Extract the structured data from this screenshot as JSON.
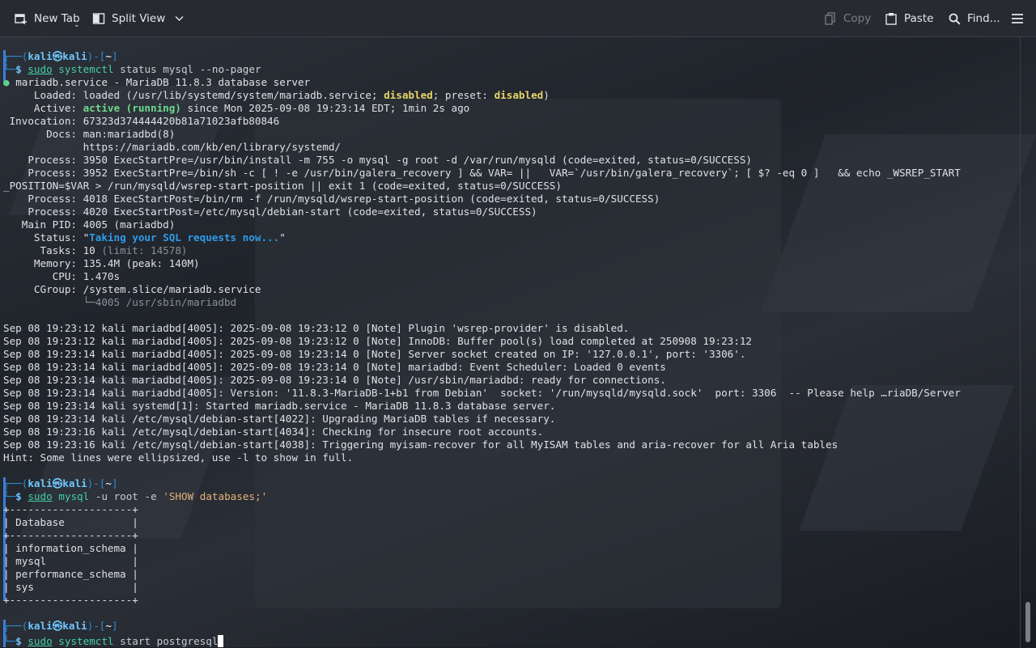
{
  "toolbar": {
    "new_tab": "New Tab",
    "split_view": "Split View",
    "copy": "Copy",
    "paste": "Paste",
    "find": "Find..."
  },
  "prompt": {
    "user": "kali",
    "host": "kali",
    "dir": "~"
  },
  "commands": {
    "c1": [
      "sudo",
      "systemctl",
      "status",
      "mysql",
      "--no-pager"
    ],
    "c2": [
      "sudo",
      "mysql",
      "-u",
      "root",
      "-e",
      "'SHOW databases;'"
    ],
    "c3": [
      "sudo",
      "systemctl",
      "start",
      "postgresql"
    ]
  },
  "status": {
    "unit": "mariadb.service - MariaDB 11.8.3 database server",
    "loaded_pre": "     Loaded: loaded (/usr/lib/systemd/system/mariadb.service; ",
    "loaded_disabled": "disabled",
    "loaded_mid": "; preset: ",
    "loaded_preset": "disabled",
    "loaded_post": ")",
    "active_pre": "     Active: ",
    "active_state": "active (running)",
    "active_post": " since Mon 2025-09-08 19:23:14 EDT; 1min 2s ago",
    "invocation": " Invocation: 67323d374444420b81a71023afb80846",
    "docs1": "       Docs: man:mariadbd(8)",
    "docs2": "             https://mariadb.com/kb/en/library/systemd/",
    "proc1": "    Process: 3950 ExecStartPre=/usr/bin/install -m 755 -o mysql -g root -d /var/run/mysqld (code=exited, status=0/SUCCESS)",
    "proc2a": "    Process: 3952 ExecStartPre=/bin/sh -c [ ! -e /usr/bin/galera_recovery ] && VAR= ||   VAR=`/usr/bin/galera_recovery`; [ $? -eq 0 ]   && echo _WSREP_START",
    "proc2b": "_POSITION=$VAR > /run/mysqld/wsrep-start-position || exit 1 (code=exited, status=0/SUCCESS)",
    "proc3": "    Process: 4018 ExecStartPost=/bin/rm -f /run/mysqld/wsrep-start-position (code=exited, status=0/SUCCESS)",
    "proc4": "    Process: 4020 ExecStartPost=/etc/mysql/debian-start (code=exited, status=0/SUCCESS)",
    "mainpid": "   Main PID: 4005 (mariadbd)",
    "status_pre": "     Status: \"",
    "status_msg": "Taking your SQL requests now...",
    "status_post": "\"",
    "tasks_pre": "      Tasks: 10 ",
    "tasks_limit": "(limit: 14578)",
    "memory": "     Memory: 135.4M (peak: 140M)",
    "cpu": "        CPU: 1.470s",
    "cgroup": "     CGroup: /system.slice/mariadb.service",
    "cgroup_child": "             └─4005 /usr/sbin/mariadbd"
  },
  "logs": [
    "Sep 08 19:23:12 kali mariadbd[4005]: 2025-09-08 19:23:12 0 [Note] Plugin 'wsrep-provider' is disabled.",
    "Sep 08 19:23:12 kali mariadbd[4005]: 2025-09-08 19:23:12 0 [Note] InnoDB: Buffer pool(s) load completed at 250908 19:23:12",
    "Sep 08 19:23:14 kali mariadbd[4005]: 2025-09-08 19:23:14 0 [Note] Server socket created on IP: '127.0.0.1', port: '3306'.",
    "Sep 08 19:23:14 kali mariadbd[4005]: 2025-09-08 19:23:14 0 [Note] mariadbd: Event Scheduler: Loaded 0 events",
    "Sep 08 19:23:14 kali mariadbd[4005]: 2025-09-08 19:23:14 0 [Note] /usr/sbin/mariadbd: ready for connections.",
    "Sep 08 19:23:14 kali mariadbd[4005]: Version: '11.8.3-MariaDB-1+b1 from Debian'  socket: '/run/mysqld/mysqld.sock'  port: 3306  -- Please help …riaDB/Server",
    "Sep 08 19:23:14 kali systemd[1]: Started mariadb.service - MariaDB 11.8.3 database server.",
    "Sep 08 19:23:14 kali /etc/mysql/debian-start[4022]: Upgrading MariaDB tables if necessary.",
    "Sep 08 19:23:16 kali /etc/mysql/debian-start[4034]: Checking for insecure root accounts.",
    "Sep 08 19:23:16 kali /etc/mysql/debian-start[4038]: Triggering myisam-recover for all MyISAM tables and aria-recover for all Aria tables",
    "Hint: Some lines were ellipsized, use -l to show in full."
  ],
  "db_table": {
    "border": "+--------------------+",
    "header": "| Database           |",
    "rows": [
      "| information_schema |",
      "| mysql              |",
      "| performance_schema |",
      "| sys                |"
    ]
  }
}
